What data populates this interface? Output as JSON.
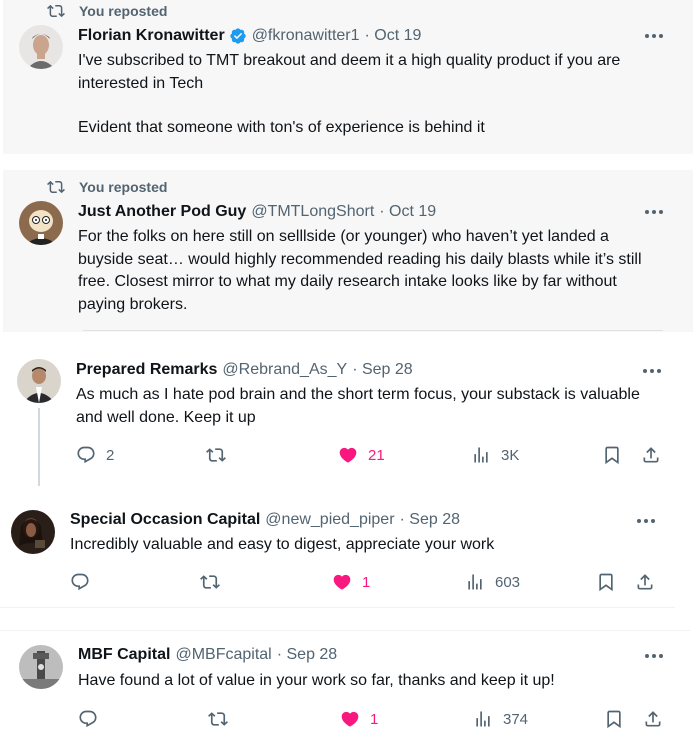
{
  "tweets": [
    {
      "reposted": "You reposted",
      "name": "Florian Kronawitter",
      "verified": true,
      "handle": "@fkronawitter1",
      "date": "· Oct 19",
      "text1": "I've subscribed to TMT breakout and deem it a high quality product if you are interested in Tech",
      "text2": "Evident that someone with ton's of experience is behind it"
    },
    {
      "reposted": "You reposted",
      "name": "Just Another Pod Guy",
      "handle": "@TMTLongShort",
      "date": "· Oct 19",
      "text1": "For the folks on here still on selllside (or younger) who haven’t yet landed a buyside seat… would highly recommended reading his daily blasts while it’s still free. Closest mirror to what my daily research intake looks like by far without paying brokers."
    },
    {
      "name": "Prepared Remarks",
      "handle": "@Rebrand_As_Y",
      "date": "· Sep 28",
      "text1": "As much as I hate pod brain and the short term focus, your substack is valuable and well done. Keep it up",
      "replies": "2",
      "reposts": "",
      "likes": "21",
      "views": "3K"
    },
    {
      "name": "Special Occasion Capital",
      "handle": "@new_pied_piper",
      "date": "· Sep 28",
      "text1": "Incredibly valuable and easy to digest, appreciate your work",
      "replies": "",
      "reposts": "",
      "likes": "1",
      "views": "603"
    },
    {
      "name": "MBF Capital",
      "handle": "@MBFcapital",
      "date": "· Sep 28",
      "text1": "Have found a lot of value in your work so far, thanks and keep it up!",
      "replies": "",
      "reposts": "",
      "likes": "1",
      "views": "374"
    }
  ],
  "colors": {
    "like": "#f91880",
    "muted": "#536471",
    "verified": "#1d9bf0"
  },
  "icons": [
    "repost-icon",
    "reply-icon",
    "heart-icon",
    "views-icon",
    "bookmark-icon",
    "share-icon",
    "more-icon",
    "verified-badge-icon"
  ]
}
